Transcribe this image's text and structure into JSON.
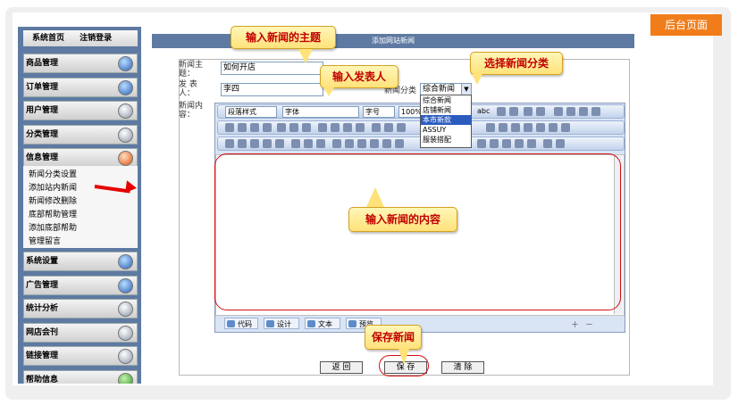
{
  "badge": "后台页面",
  "sidebar": {
    "top_links": [
      "系统首页",
      "注销登录"
    ],
    "menus": [
      {
        "label": "商品管理",
        "icon": "person-icon"
      },
      {
        "label": "订单管理",
        "icon": "globe-icon"
      },
      {
        "label": "用户管理",
        "icon": "user-icon"
      },
      {
        "label": "分类管理",
        "icon": "refresh-icon"
      },
      {
        "label": "信息管理",
        "icon": "info-icon"
      },
      {
        "label": "系统设置",
        "icon": "search-icon"
      },
      {
        "label": "广告管理",
        "icon": "globe-icon"
      },
      {
        "label": "统计分析",
        "icon": "monitor-icon"
      },
      {
        "label": "网店会刊",
        "icon": "document-icon"
      },
      {
        "label": "链接管理",
        "icon": "gear-icon"
      },
      {
        "label": "帮助信息",
        "icon": "help-icon"
      }
    ],
    "submenu": [
      "新闻分类设置",
      "添加站内新闻",
      "新闻修改删除",
      "底部帮助管理",
      "添加底部帮助",
      "管理留言"
    ]
  },
  "page": {
    "title": "添加网站新闻",
    "subject_label": "新闻主题：",
    "subject_value": "如何开店",
    "author_label": "发 表 人：",
    "author_value": "李四",
    "category_label": "新闻分类",
    "category_value": "综合新闻",
    "category_options": [
      "综合新闻",
      "店铺新闻",
      "本市新款",
      "ASSUY",
      "服装搭配"
    ],
    "content_label": "新闻内容："
  },
  "editor": {
    "toolbar_selects": [
      "段落样式",
      "字体",
      "字号",
      "100%"
    ],
    "toolbar_text": "abc",
    "tabs": [
      "代码",
      "设计",
      "文本",
      "预览"
    ]
  },
  "buttons": {
    "back": "返 回",
    "save": "保 存",
    "clear": "清 除"
  },
  "callouts": {
    "subject": "输入新闻的主题",
    "author": "输入发表人",
    "category": "选择新闻分类",
    "content": "输入新闻的内容",
    "save": "保存新闻"
  }
}
